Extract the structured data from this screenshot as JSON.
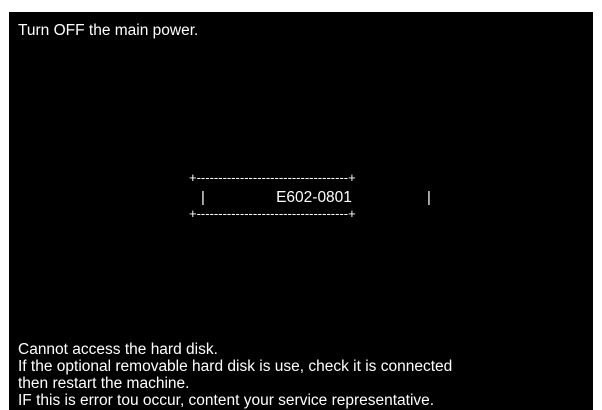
{
  "screen": {
    "top_message": "Turn OFF the main power.",
    "error_box": {
      "top_border": "+-----------------------------------+",
      "left_border": "|",
      "code": "E602-0801",
      "right_border": "|",
      "bottom_border": "+-----------------------------------+"
    },
    "bottom_message": {
      "line1": "Cannot access the hard disk.",
      "line2": "If the optional removable hard disk is use, check it is connected",
      "line3": "then restart the machine.",
      "line4": "IF this is error tou occur, content your service representative."
    }
  }
}
